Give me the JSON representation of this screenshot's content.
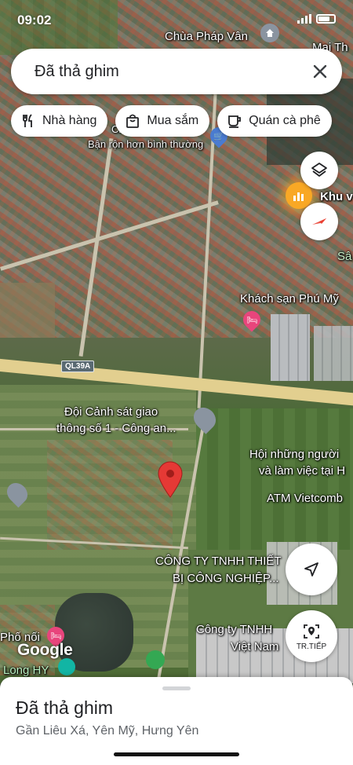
{
  "status_bar": {
    "time": "09:02"
  },
  "search": {
    "query": "Đã thả ghim"
  },
  "chips": [
    {
      "label": "Nhà hàng",
      "icon": "restaurant-icon"
    },
    {
      "label": "Mua sắm",
      "icon": "shopping-bag-icon"
    },
    {
      "label": "Quán cà phê",
      "icon": "coffee-icon"
    }
  ],
  "map": {
    "labels": {
      "pagoda": "Chùa Pháp Vân",
      "mai": "Mai Th",
      "khu": "Khu v",
      "sa": "Sâ",
      "busy": "Bận rộn hơn bình thường",
      "chu": "Chợ",
      "hotel": "Khách sạn Phú Mỹ",
      "road": "QL39A",
      "police_1": "Đội Cảnh sát giao",
      "police_2": "thông số 1 - Công an...",
      "assoc_1": "Hội những người",
      "assoc_2": "và làm việc tại H",
      "atm": "ATM Vietcomb",
      "company1_1": "CÔNG TY TNHH THIẾT",
      "company1_2": "BỊ CÔNG NGHIỆP...",
      "company2_1": "Công ty TNHH",
      "company2_2": "Việt Nam",
      "pho": "Phố nối",
      "long": "Long HY"
    },
    "logo": "Google"
  },
  "nav_button": {
    "label": "TR.TIẾP"
  },
  "sheet": {
    "title": "Đã thả ghim",
    "subtitle": "Gần Liêu Xá, Yên Mỹ, Hưng Yên"
  },
  "colors": {
    "pin_red": "#e53935",
    "compass_red": "#ea4335",
    "hotel_pink": "#e8457c",
    "busy_orange": "#f9a825"
  }
}
